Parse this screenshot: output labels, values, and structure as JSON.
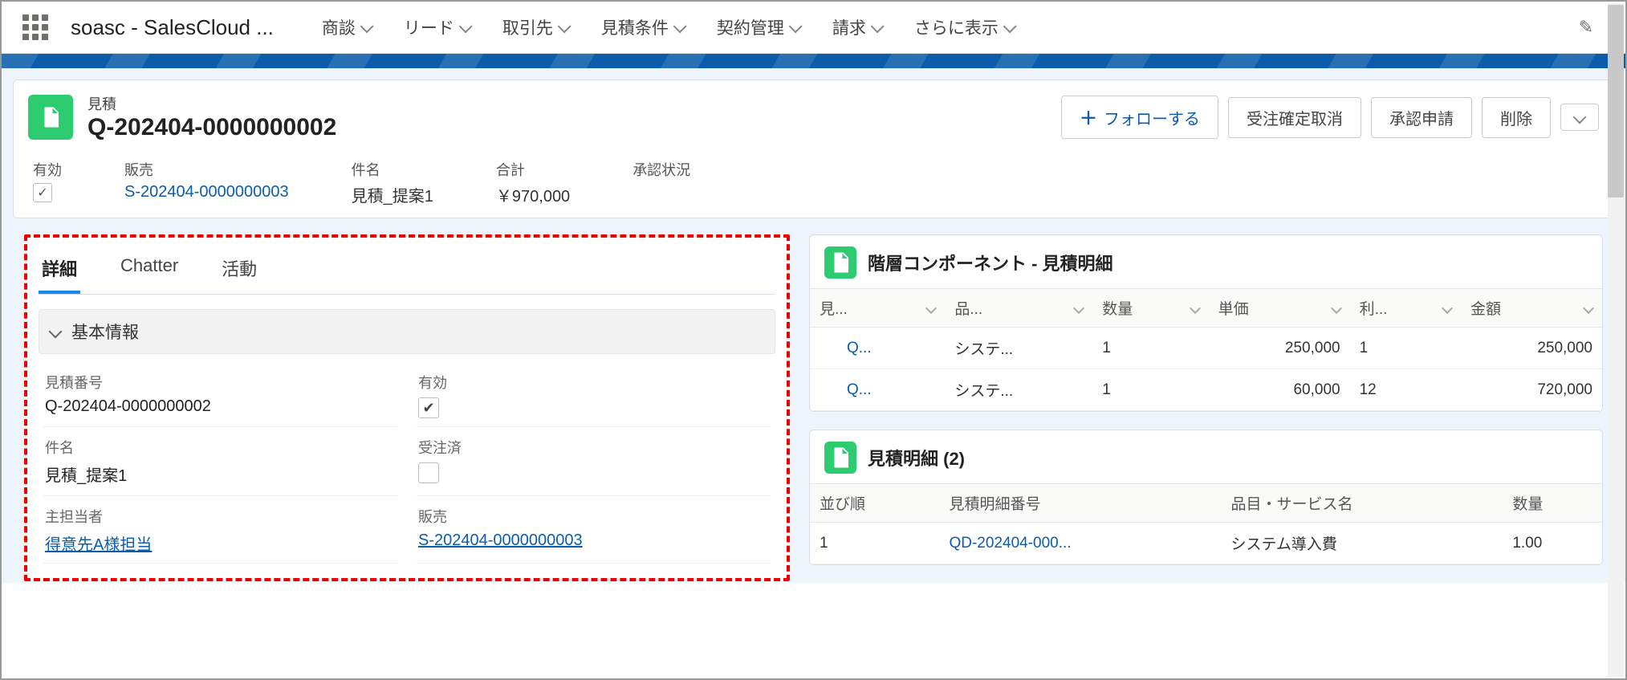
{
  "nav": {
    "app_title": "soasc - SalesCloud ...",
    "items": [
      "商談",
      "リード",
      "取引先",
      "見積条件",
      "契約管理",
      "請求",
      "さらに表示"
    ]
  },
  "record": {
    "type_label": "見積",
    "title": "Q-202404-0000000002",
    "actions": {
      "follow": "フォローする",
      "cancel_order": "受注確定取消",
      "submit_approval": "承認申請",
      "delete": "削除"
    },
    "summary": [
      {
        "label": "有効",
        "type": "check",
        "checked": true
      },
      {
        "label": "販売",
        "type": "link",
        "value": "S-202404-0000000003"
      },
      {
        "label": "件名",
        "type": "text",
        "value": "見積_提案1"
      },
      {
        "label": "合計",
        "type": "text",
        "value": "￥970,000"
      },
      {
        "label": "承認状況",
        "type": "text",
        "value": ""
      }
    ]
  },
  "tabs": [
    "詳細",
    "Chatter",
    "活動"
  ],
  "detail": {
    "section_title": "基本情報",
    "fields": [
      {
        "label": "見積番号",
        "type": "text",
        "value": "Q-202404-0000000002"
      },
      {
        "label": "有効",
        "type": "check",
        "checked": true
      },
      {
        "label": "件名",
        "type": "text",
        "value": "見積_提案1"
      },
      {
        "label": "受注済",
        "type": "check",
        "checked": false
      },
      {
        "label": "主担当者",
        "type": "link",
        "value": "得意先A様担当"
      },
      {
        "label": "販売",
        "type": "link",
        "value": "S-202404-0000000003"
      }
    ]
  },
  "hierarchy_panel": {
    "title": "階層コンポーネント - 見積明細",
    "columns": [
      "見...",
      "品...",
      "数量",
      "単価",
      "利...",
      "金額"
    ],
    "rows": [
      {
        "c0": "Q...",
        "c1": "システ...",
        "c2": "1",
        "c3": "250,000",
        "c4": "1",
        "c5": "250,000"
      },
      {
        "c0": "Q...",
        "c1": "システ...",
        "c2": "1",
        "c3": "60,000",
        "c4": "12",
        "c5": "720,000"
      }
    ]
  },
  "lineitem_panel": {
    "title": "見積明細 (2)",
    "columns": [
      "並び順",
      "見積明細番号",
      "品目・サービス名",
      "数量"
    ],
    "rows": [
      {
        "c0": "1",
        "c1": "QD-202404-000...",
        "c2": "システム導入費",
        "c3": "1.00"
      }
    ]
  }
}
